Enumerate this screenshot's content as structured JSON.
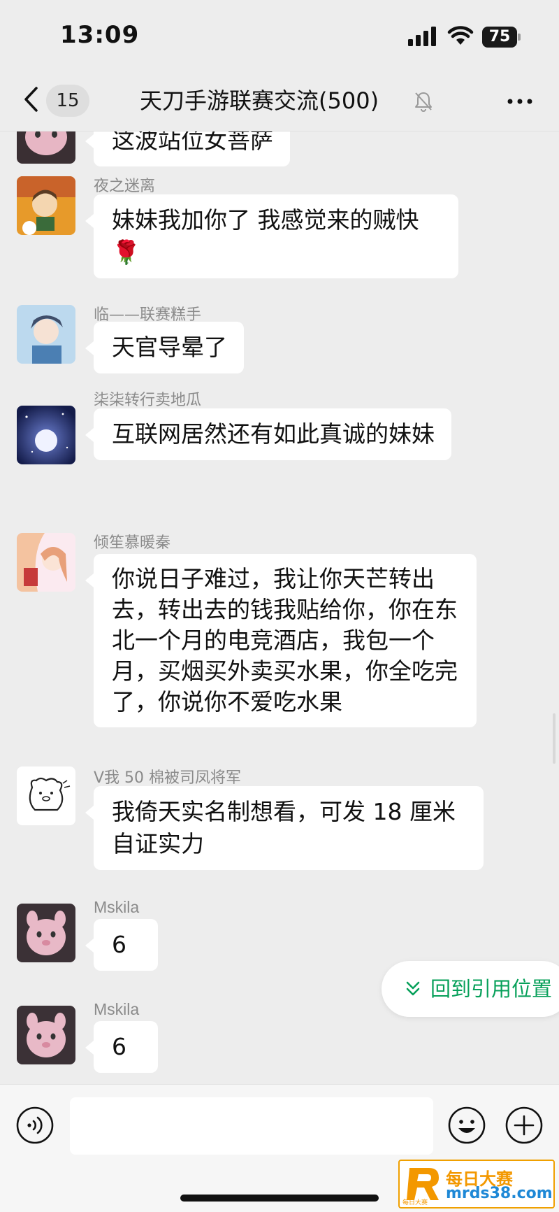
{
  "status_bar": {
    "time": "13:09",
    "battery": "75"
  },
  "nav": {
    "unread_count": "15",
    "title": "天刀手游联赛交流(500)"
  },
  "messages": [
    {
      "sender": "",
      "text": "这波站位女菩萨"
    },
    {
      "sender": "夜之迷离",
      "text": "妹妹我加你了 我感觉来的贼快",
      "emoji": "🌹"
    },
    {
      "sender": "临——联赛糕手",
      "text": "天官导晕了"
    },
    {
      "sender": "柒柒转行卖地瓜",
      "text": "互联网居然还有如此真诚的妹妹"
    },
    {
      "sender": "倾笙慕暖秦",
      "text": "你说日子难过，我让你天芒转出去，转出去的钱我贴给你，你在东北一个月的电竞酒店，我包一个月，买烟买外卖买水果，你全吃完了，你说你不爱吃水果"
    },
    {
      "sender": "V我 50 棉被司凤将军",
      "text": "我倚天实名制想看，可发 18 厘米自证实力"
    },
    {
      "sender": "Mskila",
      "text": "6"
    },
    {
      "sender": "Mskila",
      "text": "6"
    }
  ],
  "quote_jump": {
    "label": "回到引用位置"
  },
  "input": {
    "placeholder": ""
  },
  "watermark": {
    "line1": "每日大赛",
    "line2": "mrds38.com",
    "sub": "每日大赛"
  },
  "colors": {
    "accent": "#07a05a",
    "background": "#ededed",
    "bubble": "#ffffff"
  }
}
